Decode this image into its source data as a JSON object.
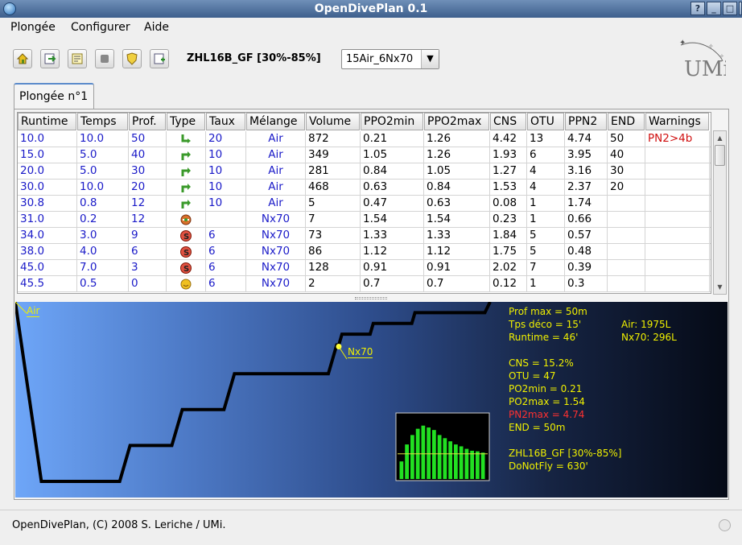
{
  "window": {
    "title": "OpenDivePlan 0.1"
  },
  "menu": [
    "Plongée",
    "Configurer",
    "Aide"
  ],
  "toolbar": {
    "icons": [
      "home-icon",
      "export-icon",
      "notes-icon",
      "stop-icon",
      "shield-icon",
      "add-icon"
    ],
    "model": "ZHL16B_GF [30%-85%]",
    "mix_selected": "15Air_6Nx70"
  },
  "logo": {
    "text": "UMi"
  },
  "tab": {
    "label": "Plongée n°1"
  },
  "table": {
    "columns": [
      "Runtime",
      "Temps",
      "Prof.",
      "Type",
      "Taux",
      "Mélange",
      "Volume",
      "PPO2min",
      "PPO2max",
      "CNS",
      "OTU",
      "PPN2",
      "END",
      "Warnings"
    ],
    "rows": [
      {
        "runtime": "10.0",
        "temps": "10.0",
        "prof": "50",
        "type": "descent-icon",
        "taux": "20",
        "melange": "Air",
        "volume": "872",
        "ppo2min": "0.21",
        "ppo2max": "1.26",
        "cns": "4.42",
        "otu": "13",
        "ppn2": "4.74",
        "end": "50",
        "warnings": "PN2>4b"
      },
      {
        "runtime": "15.0",
        "temps": "5.0",
        "prof": "40",
        "type": "ascent-icon",
        "taux": "10",
        "melange": "Air",
        "volume": "349",
        "ppo2min": "1.05",
        "ppo2max": "1.26",
        "cns": "1.93",
        "otu": "6",
        "ppn2": "3.95",
        "end": "40",
        "warnings": ""
      },
      {
        "runtime": "20.0",
        "temps": "5.0",
        "prof": "30",
        "type": "ascent-icon",
        "taux": "10",
        "melange": "Air",
        "volume": "281",
        "ppo2min": "0.84",
        "ppo2max": "1.05",
        "cns": "1.27",
        "otu": "4",
        "ppn2": "3.16",
        "end": "30",
        "warnings": ""
      },
      {
        "runtime": "30.0",
        "temps": "10.0",
        "prof": "20",
        "type": "ascent-icon",
        "taux": "10",
        "melange": "Air",
        "volume": "468",
        "ppo2min": "0.63",
        "ppo2max": "0.84",
        "cns": "1.53",
        "otu": "4",
        "ppn2": "2.37",
        "end": "20",
        "warnings": ""
      },
      {
        "runtime": "30.8",
        "temps": "0.8",
        "prof": "12",
        "type": "ascent-icon",
        "taux": "10",
        "melange": "Air",
        "volume": "5",
        "ppo2min": "0.47",
        "ppo2max": "0.63",
        "cns": "0.08",
        "otu": "1",
        "ppn2": "1.74",
        "end": "",
        "warnings": ""
      },
      {
        "runtime": "31.0",
        "temps": "0.2",
        "prof": "12",
        "type": "gas-switch-icon",
        "taux": "",
        "melange": "Nx70",
        "volume": "7",
        "ppo2min": "1.54",
        "ppo2max": "1.54",
        "cns": "0.23",
        "otu": "1",
        "ppn2": "0.66",
        "end": "",
        "warnings": ""
      },
      {
        "runtime": "34.0",
        "temps": "3.0",
        "prof": "9",
        "type": "stop-icon",
        "taux": "6",
        "melange": "Nx70",
        "volume": "73",
        "ppo2min": "1.33",
        "ppo2max": "1.33",
        "cns": "1.84",
        "otu": "5",
        "ppn2": "0.57",
        "end": "",
        "warnings": ""
      },
      {
        "runtime": "38.0",
        "temps": "4.0",
        "prof": "6",
        "type": "stop-icon",
        "taux": "6",
        "melange": "Nx70",
        "volume": "86",
        "ppo2min": "1.12",
        "ppo2max": "1.12",
        "cns": "1.75",
        "otu": "5",
        "ppn2": "0.48",
        "end": "",
        "warnings": ""
      },
      {
        "runtime": "45.0",
        "temps": "7.0",
        "prof": "3",
        "type": "stop-icon",
        "taux": "6",
        "melange": "Nx70",
        "volume": "128",
        "ppo2min": "0.91",
        "ppo2max": "0.91",
        "cns": "2.02",
        "otu": "7",
        "ppn2": "0.39",
        "end": "",
        "warnings": ""
      },
      {
        "runtime": "45.5",
        "temps": "0.5",
        "prof": "0",
        "type": "surface-icon",
        "taux": "6",
        "melange": "Nx70",
        "volume": "2",
        "ppo2min": "0.7",
        "ppo2max": "0.7",
        "cns": "0.12",
        "otu": "1",
        "ppn2": "0.3",
        "end": "",
        "warnings": ""
      }
    ]
  },
  "graph": {
    "gas_labels": [
      "Air",
      "Nx70"
    ],
    "profile": {
      "runtime_min": [
        0,
        2.5,
        10.0,
        11.0,
        15.0,
        16.0,
        20.0,
        21.0,
        30.0,
        30.8,
        31.0,
        31.3,
        34.0,
        34.3,
        38.0,
        38.3,
        45.0,
        45.5
      ],
      "depth_m": [
        0,
        50,
        50,
        40,
        40,
        30,
        30,
        20,
        20,
        12,
        12,
        9,
        9,
        6,
        6,
        3,
        3,
        0
      ]
    },
    "stats_left": [
      {
        "text": "Prof max = 50m",
        "color": "#f0f000"
      },
      {
        "text": "Tps déco = 15'",
        "color": "#f0f000"
      },
      {
        "text": "Runtime = 46'",
        "color": "#f0f000"
      },
      {
        "text": "",
        "color": "#f0f000"
      },
      {
        "text": "CNS = 15.2%",
        "color": "#f0f000"
      },
      {
        "text": "OTU = 47",
        "color": "#f0f000"
      },
      {
        "text": "PO2min = 0.21",
        "color": "#f0f000"
      },
      {
        "text": "PO2max = 1.54",
        "color": "#f0f000"
      },
      {
        "text": "PN2max = 4.74",
        "color": "#ff3030"
      },
      {
        "text": "END = 50m",
        "color": "#f0f000"
      },
      {
        "text": "",
        "color": "#f0f000"
      },
      {
        "text": "ZHL16B_GF [30%-85%]",
        "color": "#f0f000"
      },
      {
        "text": "DoNotFly = 630'",
        "color": "#f0f000"
      }
    ],
    "stats_right": [
      "Air: 1975L",
      "Nx70: 296L"
    ],
    "tissue_bars": [
      0.28,
      0.55,
      0.7,
      0.8,
      0.85,
      0.82,
      0.78,
      0.7,
      0.65,
      0.6,
      0.55,
      0.52,
      0.48,
      0.45,
      0.44,
      0.42
    ],
    "tissue_reference_line": 0.4
  },
  "status": {
    "text": "OpenDivePlan, (C) 2008 S. Leriche / UMi."
  }
}
